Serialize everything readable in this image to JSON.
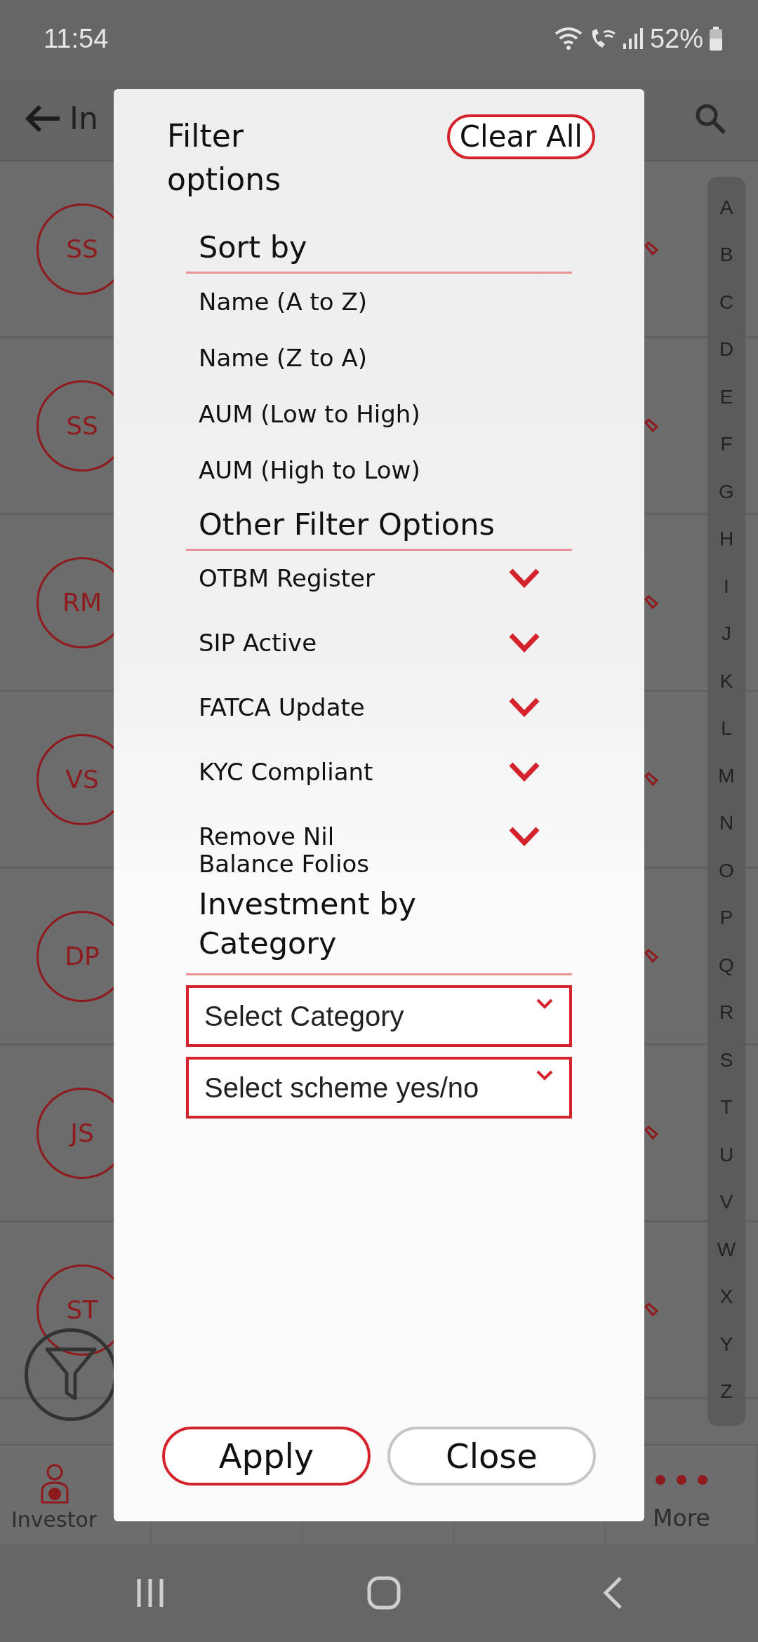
{
  "status_bar": {
    "time": "11:54",
    "battery": "52%"
  },
  "header": {
    "title": "In"
  },
  "contacts": [
    {
      "initials": "SS"
    },
    {
      "initials": "SS"
    },
    {
      "initials": "RM"
    },
    {
      "initials": "VS"
    },
    {
      "initials": "DP"
    },
    {
      "initials": "JS"
    },
    {
      "initials": "ST"
    },
    {
      "kind": "blank"
    }
  ],
  "index_letters": [
    "A",
    "B",
    "C",
    "D",
    "E",
    "F",
    "G",
    "H",
    "I",
    "J",
    "K",
    "L",
    "M",
    "N",
    "O",
    "P",
    "Q",
    "R",
    "S",
    "T",
    "U",
    "V",
    "W",
    "X",
    "Y",
    "Z"
  ],
  "dialog": {
    "title": "Filter options",
    "clear_button": "Clear All",
    "sections": [
      {
        "heading": "Sort by",
        "kind": "options",
        "items": [
          {
            "label": "Name (A to Z)"
          },
          {
            "label": "Name (Z to A)"
          },
          {
            "label": "AUM (Low to High)"
          },
          {
            "label": "AUM (High to Low)"
          }
        ]
      },
      {
        "heading": "Other Filter Options",
        "kind": "toggles",
        "items": [
          {
            "label": "OTBM Register"
          },
          {
            "label": "SIP Active"
          },
          {
            "label": "FATCA Update"
          },
          {
            "label": "KYC Compliant"
          },
          {
            "label": "Remove Nil Balance Folios"
          }
        ]
      },
      {
        "heading": "Investment by Category",
        "kind": "selects",
        "items": [
          {
            "placeholder": "Select Category"
          },
          {
            "placeholder": "Select scheme yes/no"
          }
        ]
      }
    ],
    "buttons": [
      {
        "label": "Apply",
        "kind": "primary"
      },
      {
        "label": "Close",
        "kind": "secondary"
      }
    ]
  },
  "bottom_nav": [
    {
      "label": "Investor",
      "kind": "investor"
    },
    {
      "kind": "covered"
    },
    {
      "kind": "covered"
    },
    {
      "kind": "covered"
    },
    {
      "label": "More",
      "kind": "more"
    }
  ]
}
